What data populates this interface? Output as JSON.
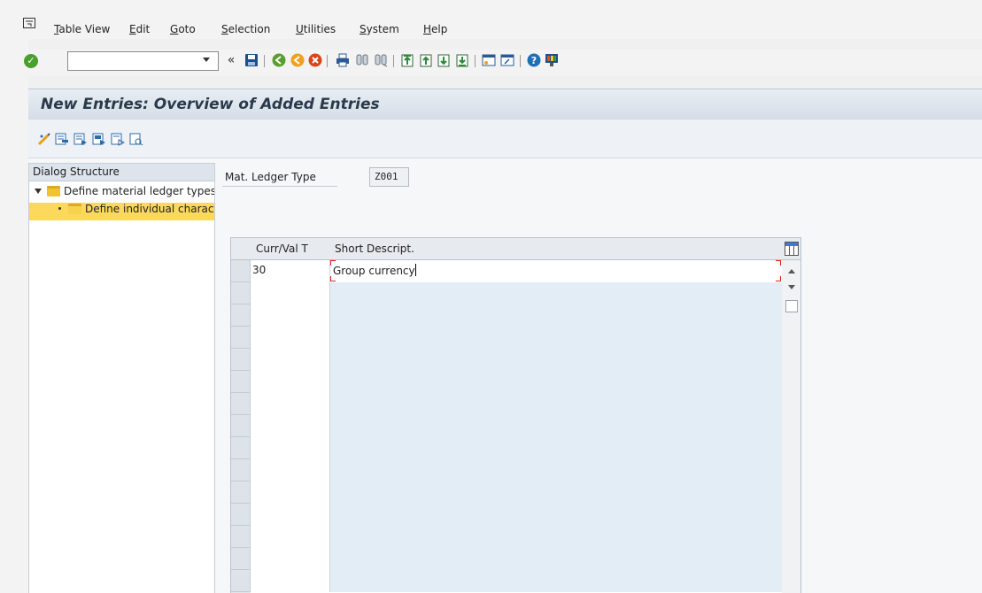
{
  "menu": {
    "items": [
      "Table View",
      "Edit",
      "Goto",
      "Selection",
      "Utilities",
      "System",
      "Help"
    ]
  },
  "toolbar": {
    "command_value": "",
    "back_glyph": "«",
    "icons": [
      "save-icon",
      "back-icon",
      "exit-icon",
      "cancel-icon",
      "print-icon",
      "find-icon",
      "find-next-icon",
      "first-page-icon",
      "previous-page-icon",
      "next-page-icon",
      "last-page-icon",
      "create-session-icon",
      "shortcut-icon",
      "help-icon",
      "customize-layout-icon"
    ]
  },
  "title": "New Entries: Overview of Added Entries",
  "app_toolbar": {
    "icons": [
      "change-display-icon",
      "delete-icon",
      "select-all-icon",
      "select-block-icon",
      "deselect-all-icon",
      "details-icon"
    ]
  },
  "dialog": {
    "header": "Dialog Structure",
    "items": [
      {
        "label": "Define material ledger types"
      },
      {
        "label": "Define individual characteristics"
      }
    ]
  },
  "field": {
    "label": "Mat. Ledger Type",
    "value": "Z001"
  },
  "table": {
    "columns": [
      "Curr/Val T",
      "Short Descript."
    ],
    "rows": [
      {
        "curr": "30",
        "desc": "Group currency"
      }
    ],
    "empty_rows": 14
  },
  "colors": {
    "title_text": "#2b3a4a",
    "selection_highlight": "#fcd85d",
    "ok_green": "#4aa02c",
    "row_alt": "#e3edf6"
  }
}
